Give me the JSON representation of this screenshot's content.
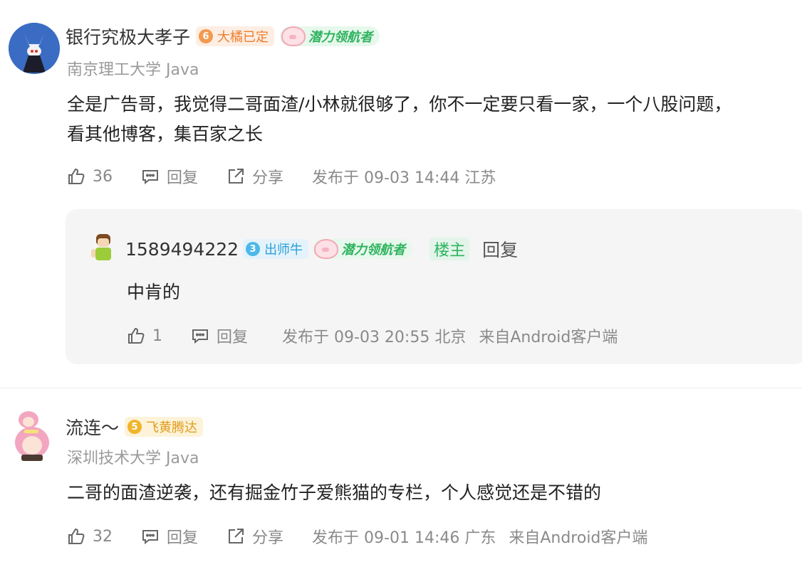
{
  "comments": [
    {
      "username": "银行究极大孝子",
      "level_num": "6",
      "level_name": "大橘已定",
      "honor": "潜力领航者",
      "school": "南京理工大学 Java",
      "content_lines": [
        "全是广告哥，我觉得二哥面渣/小林就很够了，你不一定要只看一家，一个八股问题，",
        "看其他博客，集百家之长"
      ],
      "likes": "36",
      "reply_label": "回复",
      "share_label": "分享",
      "publish": "发布于 09-03 14:44 江苏",
      "reply": {
        "username": "1589494222",
        "level_num": "3",
        "level_name": "出师牛",
        "honor": "潜力领航者",
        "owner_badge": "楼主",
        "reply_action": "回复",
        "content": "中肯的",
        "likes": "1",
        "reply_label": "回复",
        "publish": "发布于 09-03 20:55 北京",
        "source": "来自Android客户端"
      }
    },
    {
      "username": "流连～",
      "level_num": "5",
      "level_name": "飞黄腾达",
      "school": "深圳技术大学 Java",
      "content": "二哥的面渣逆袭，还有掘金竹子爱熊猫的专栏，个人感觉还是不错的",
      "likes": "32",
      "reply_label": "回复",
      "share_label": "分享",
      "publish": "发布于 09-01 14:46 广东",
      "source": "来自Android客户端"
    }
  ],
  "colors": {
    "level_orange_bg": "#fdeee3",
    "level_orange_text": "#f07c2c",
    "level_blue_bg": "#e4f3fb",
    "level_blue_text": "#2ba0d9",
    "level_gold_bg": "#fdf3d9",
    "level_gold_text": "#e09b1a",
    "honor_green": "#2eb35e",
    "owner_badge_green": "#2eb35e"
  }
}
